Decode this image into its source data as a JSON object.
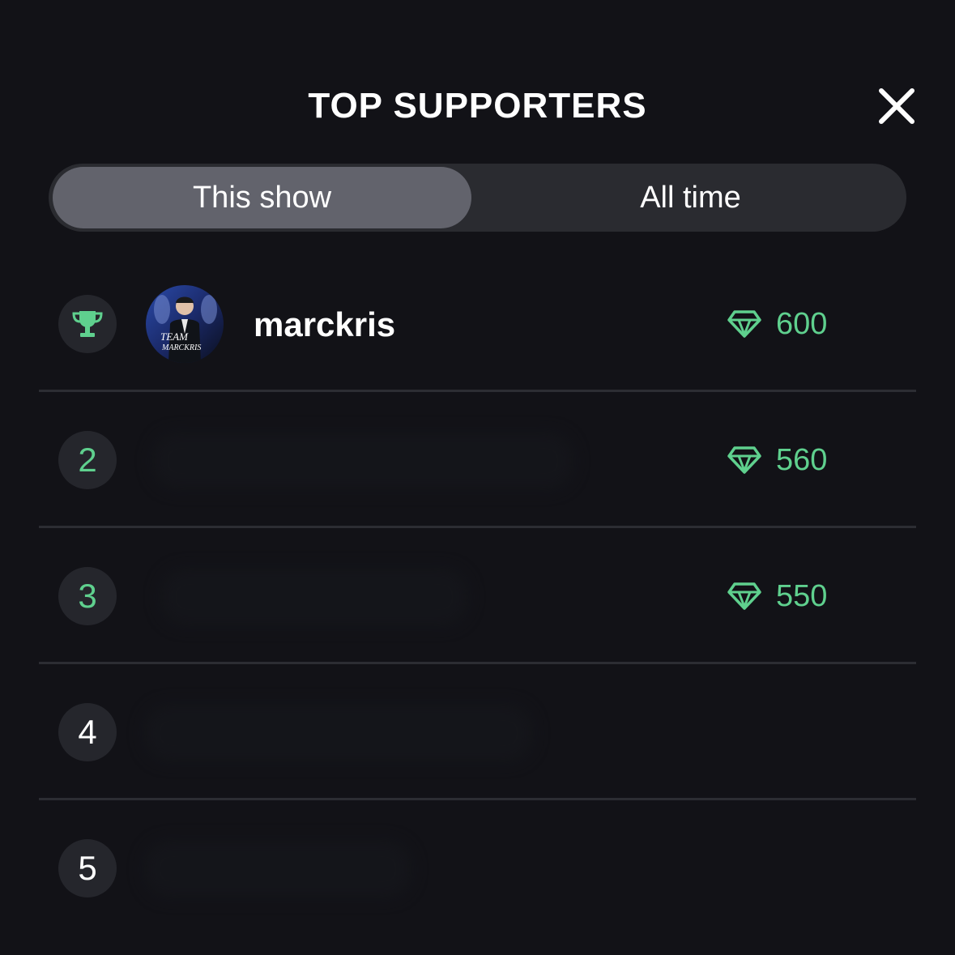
{
  "header": {
    "title": "TOP SUPPORTERS",
    "close_icon": "close-icon"
  },
  "tabs": [
    {
      "label": "This show",
      "active": true
    },
    {
      "label": "All time",
      "active": false
    }
  ],
  "supporters": [
    {
      "rank": "1",
      "rank_icon": "trophy-icon",
      "username": "marckris",
      "avatar_text_1": "TEAM",
      "avatar_text_2": "MARCKRIS",
      "gems": "600"
    },
    {
      "rank": "2",
      "username": "",
      "gems": "560"
    },
    {
      "rank": "3",
      "username": "",
      "gems": "550"
    },
    {
      "rank": "4",
      "username": "",
      "gems": ""
    },
    {
      "rank": "5",
      "username": "",
      "gems": ""
    }
  ],
  "colors": {
    "background": "#121217",
    "accent_green": "#5fd08e",
    "segment_bg": "#2a2b30",
    "segment_active": "#62636c",
    "rank_circle": "#25262c",
    "divider": "#2c2d33"
  }
}
